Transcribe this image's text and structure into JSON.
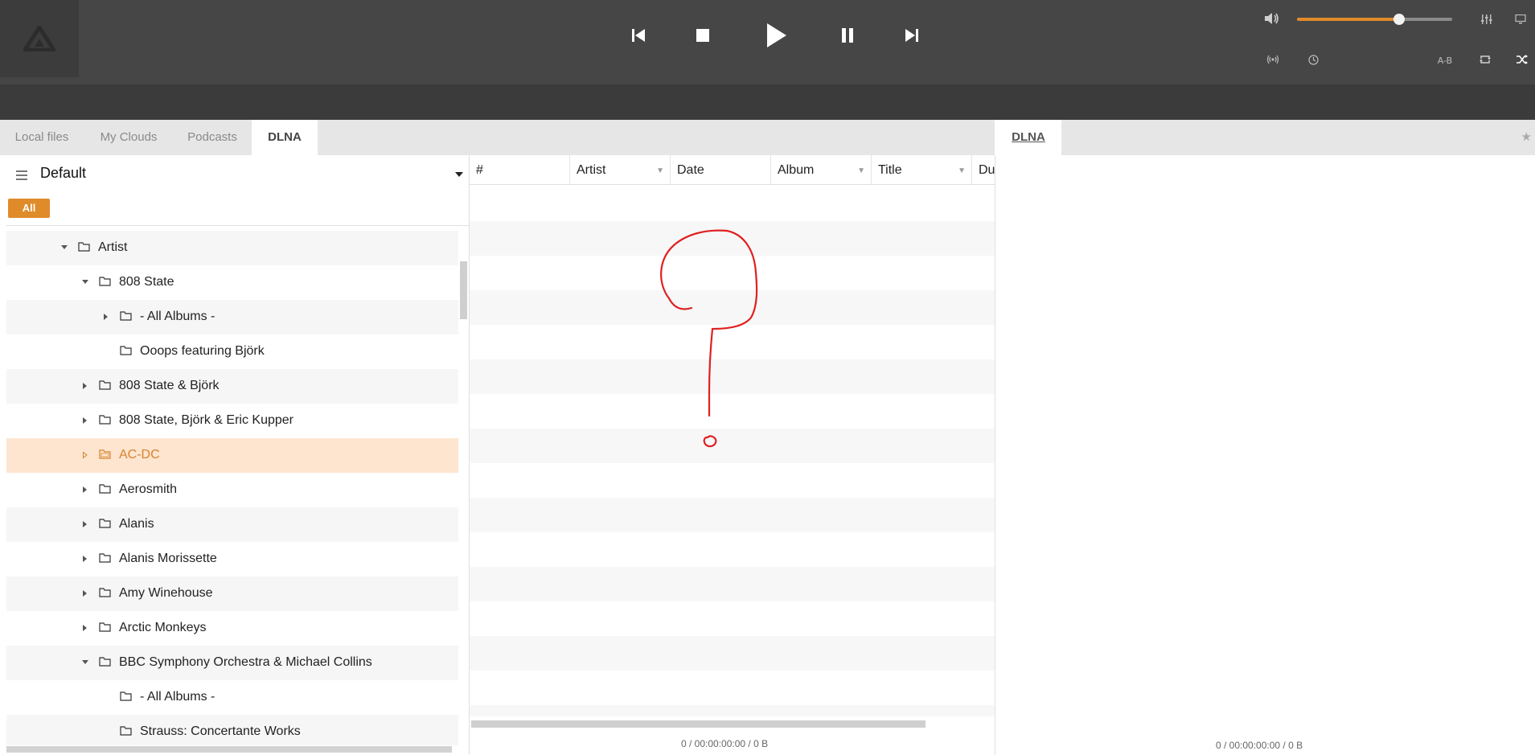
{
  "player": {
    "controls": [
      "previous",
      "stop",
      "play",
      "pause",
      "next"
    ],
    "volume_fraction": 0.66,
    "ab_label": "A-B",
    "icons": [
      "volume-icon",
      "equalizer-icon",
      "output-icon",
      "broadcast-icon",
      "timer-icon",
      "ab-repeat-icon",
      "repeat-icon",
      "shuffle-icon"
    ]
  },
  "tabs_left": [
    {
      "label": "Local files",
      "active": false
    },
    {
      "label": "My Clouds",
      "active": false
    },
    {
      "label": "Podcasts",
      "active": false
    },
    {
      "label": "DLNA",
      "active": true
    }
  ],
  "tab_right": {
    "label": "DLNA"
  },
  "library": {
    "profile": "Default",
    "filter": "All",
    "tree": [
      {
        "label": "Artist",
        "expanded": true,
        "level": 0
      },
      {
        "label": "808 State",
        "expanded": true,
        "level": 1
      },
      {
        "label": "- All Albums -",
        "expanded": false,
        "level": 2
      },
      {
        "label": "Ooops featuring Björk",
        "expanded": null,
        "level": 2
      },
      {
        "label": "808 State & Björk",
        "expanded": false,
        "level": 1
      },
      {
        "label": "808 State, Björk & Eric Kupper",
        "expanded": false,
        "level": 1
      },
      {
        "label": "AC-DC",
        "expanded": false,
        "level": 1,
        "selected": true
      },
      {
        "label": "Aerosmith",
        "expanded": false,
        "level": 1
      },
      {
        "label": "Alanis",
        "expanded": false,
        "level": 1
      },
      {
        "label": "Alanis Morissette",
        "expanded": false,
        "level": 1
      },
      {
        "label": "Amy Winehouse",
        "expanded": false,
        "level": 1
      },
      {
        "label": "Arctic Monkeys",
        "expanded": false,
        "level": 1
      },
      {
        "label": "BBC Symphony Orchestra & Michael Collins",
        "expanded": true,
        "level": 1
      },
      {
        "label": "- All Albums -",
        "expanded": null,
        "level": 2
      },
      {
        "label": "Strauss: Concertante Works",
        "expanded": null,
        "level": 2
      }
    ]
  },
  "tracklist": {
    "columns": [
      "#",
      "Artist",
      "Date",
      "Album",
      "Title",
      "Du"
    ],
    "status": "0 / 00:00:00:00 / 0 B"
  },
  "playlist": {
    "status": "0 / 00:00:00:00 / 0 B"
  },
  "colors": {
    "accent": "#e08b2a",
    "selected_row": "#fde5d0",
    "topbar": "#464646",
    "annotation": "#e02020"
  }
}
